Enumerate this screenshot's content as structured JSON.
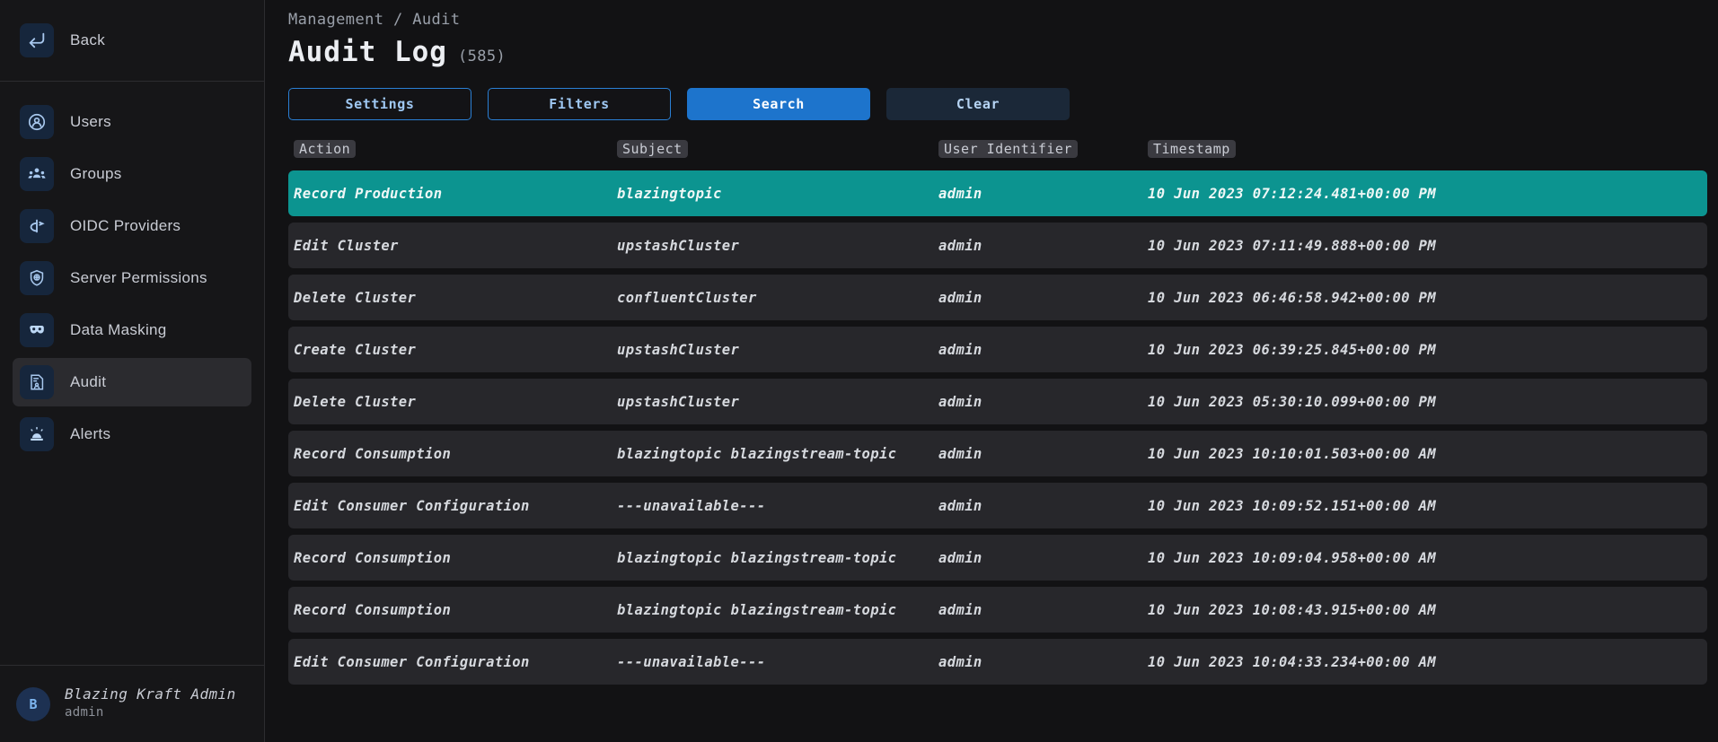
{
  "sidebar": {
    "back": {
      "label": "Back",
      "icon": "back-arrow-icon"
    },
    "items": [
      {
        "label": "Users",
        "icon": "user-circle-icon",
        "active": false
      },
      {
        "label": "Groups",
        "icon": "groups-icon",
        "active": false
      },
      {
        "label": "OIDC Providers",
        "icon": "oidc-icon",
        "active": false
      },
      {
        "label": "Server Permissions",
        "icon": "shield-icon",
        "active": false
      },
      {
        "label": "Data Masking",
        "icon": "mask-icon",
        "active": false
      },
      {
        "label": "Audit",
        "icon": "audit-document-icon",
        "active": true
      },
      {
        "label": "Alerts",
        "icon": "alarm-light-icon",
        "active": false
      }
    ],
    "profile": {
      "initial": "B",
      "name": "Blazing Kraft Admin",
      "username": "admin"
    }
  },
  "header": {
    "breadcrumb": "Management / Audit",
    "title": "Audit Log",
    "count": "(585)"
  },
  "toolbar": {
    "settings_label": "Settings",
    "filters_label": "Filters",
    "search_label": "Search",
    "clear_label": "Clear"
  },
  "table": {
    "columns": [
      "Action",
      "Subject",
      "User Identifier",
      "Timestamp"
    ],
    "rows": [
      {
        "action": "Record Production",
        "subject": "blazingtopic",
        "user": "admin",
        "timestamp": "10 Jun 2023 07:12:24.481+00:00 PM",
        "selected": true
      },
      {
        "action": "Edit Cluster",
        "subject": "upstashCluster",
        "user": "admin",
        "timestamp": "10 Jun 2023 07:11:49.888+00:00 PM",
        "selected": false
      },
      {
        "action": "Delete Cluster",
        "subject": "confluentCluster",
        "user": "admin",
        "timestamp": "10 Jun 2023 06:46:58.942+00:00 PM",
        "selected": false
      },
      {
        "action": "Create Cluster",
        "subject": "upstashCluster",
        "user": "admin",
        "timestamp": "10 Jun 2023 06:39:25.845+00:00 PM",
        "selected": false
      },
      {
        "action": "Delete Cluster",
        "subject": "upstashCluster",
        "user": "admin",
        "timestamp": "10 Jun 2023 05:30:10.099+00:00 PM",
        "selected": false
      },
      {
        "action": "Record Consumption",
        "subject": "blazingtopic blazingstream-topic",
        "user": "admin",
        "timestamp": "10 Jun 2023 10:10:01.503+00:00 AM",
        "selected": false
      },
      {
        "action": "Edit Consumer Configuration",
        "subject": "---unavailable---",
        "user": "admin",
        "timestamp": "10 Jun 2023 10:09:52.151+00:00 AM",
        "selected": false
      },
      {
        "action": "Record Consumption",
        "subject": "blazingtopic blazingstream-topic",
        "user": "admin",
        "timestamp": "10 Jun 2023 10:09:04.958+00:00 AM",
        "selected": false
      },
      {
        "action": "Record Consumption",
        "subject": "blazingtopic blazingstream-topic",
        "user": "admin",
        "timestamp": "10 Jun 2023 10:08:43.915+00:00 AM",
        "selected": false
      },
      {
        "action": "Edit Consumer Configuration",
        "subject": "---unavailable---",
        "user": "admin",
        "timestamp": "10 Jun 2023 10:04:33.234+00:00 AM",
        "selected": false
      }
    ]
  },
  "colors": {
    "accent_blue": "#1d74cc",
    "selected_row_teal": "#0c9490",
    "row_bg": "#27272b",
    "sidebar_bg": "#161618",
    "page_bg": "#121214"
  }
}
